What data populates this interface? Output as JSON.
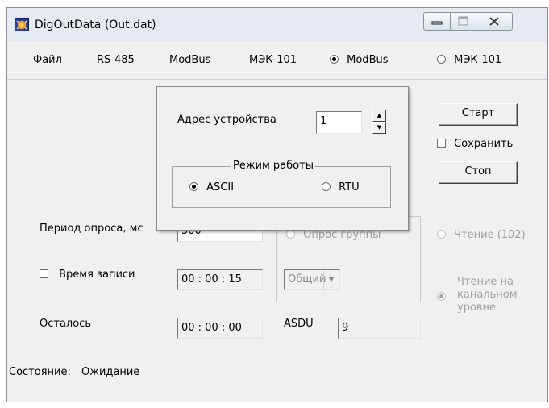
{
  "window": {
    "title": "DigOutData (Out.dat)"
  },
  "menu": {
    "file": "Файл",
    "rs485": "RS-485",
    "modbus": "ModBus",
    "iec101": "МЭК-101",
    "radio_modbus": "ModBus",
    "radio_iec101": "МЭК-101",
    "selected_protocol": "ModBus"
  },
  "popup": {
    "address_label": "Адрес устройства",
    "address_value": "1",
    "mode_group_label": "Режим работы",
    "mode_ascii": "ASCII",
    "mode_rtu": "RTU",
    "selected_mode": "ASCII"
  },
  "main": {
    "period_label": "Период опроса, мс",
    "period_value": "500",
    "record_time_label": "Время записи",
    "record_time_value": "00 : 00 : 15",
    "remaining_label": "Осталось",
    "remaining_value": "00 : 00 : 00",
    "group_poll_label": "Опрос группы",
    "group_select_value": "Общий",
    "asdu_label": "ASDU",
    "asdu_value": "9",
    "status_label": "Состояние:",
    "status_value": "Ожидание"
  },
  "right": {
    "start_button": "Старт",
    "save_label": "Сохранить",
    "stop_button": "Стоп",
    "read_102_label": "Чтение (102)",
    "read_channel_label": "Чтение на канальном уровне"
  },
  "colors": {
    "titlebar": "#e6ebf2",
    "window_bg": "#f0f0f0",
    "disabled_text": "#a0a0a0"
  }
}
